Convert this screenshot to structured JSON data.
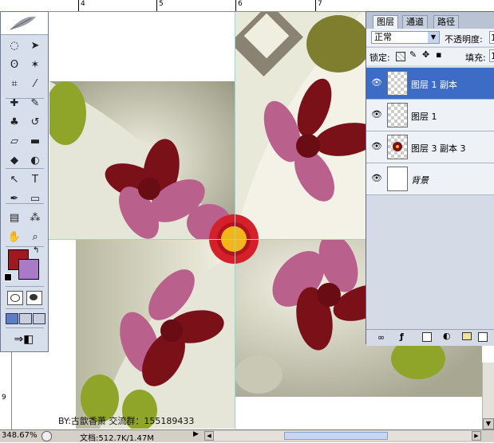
{
  "rulers": {
    "top_labels": [
      "4",
      "5",
      "6",
      "7"
    ],
    "left_labels": [
      "9"
    ]
  },
  "canvas": {
    "watermark": "BY:古歆香萧  交流群：155189433",
    "colors": {
      "petal_dark": "#7a1018",
      "petal_pink": "#b9608c",
      "leaf_green": "#8fa52a",
      "bg_cream": "#e8e7d3",
      "center_red": "#d4202a",
      "center_yellow": "#f4b51a",
      "guide": "#7fe0e0"
    }
  },
  "toolbox": {
    "tools": [
      {
        "name": "marquee-tool-icon",
        "glyph": "◌"
      },
      {
        "name": "move-tool-icon",
        "glyph": "➤"
      },
      {
        "name": "lasso-tool-icon",
        "glyph": "ʘ"
      },
      {
        "name": "magic-wand-tool-icon",
        "glyph": "✶"
      },
      {
        "name": "crop-tool-icon",
        "glyph": "⌗"
      },
      {
        "name": "slice-tool-icon",
        "glyph": "⁄"
      },
      {
        "name": "healing-brush-icon",
        "glyph": "✚"
      },
      {
        "name": "brush-tool-icon",
        "glyph": "✎"
      },
      {
        "name": "stamp-tool-icon",
        "glyph": "♣"
      },
      {
        "name": "history-brush-icon",
        "glyph": "↺"
      },
      {
        "name": "eraser-tool-icon",
        "glyph": "▱"
      },
      {
        "name": "gradient-tool-icon",
        "glyph": "▬"
      },
      {
        "name": "blur-tool-icon",
        "glyph": "◆"
      },
      {
        "name": "dodge-tool-icon",
        "glyph": "◐"
      },
      {
        "name": "path-select-tool-icon",
        "glyph": "↖"
      },
      {
        "name": "type-tool-icon",
        "glyph": "T"
      },
      {
        "name": "pen-tool-icon",
        "glyph": "✒"
      },
      {
        "name": "shape-tool-icon",
        "glyph": "▭"
      },
      {
        "name": "notes-tool-icon",
        "glyph": "▤"
      },
      {
        "name": "eyedropper-tool-icon",
        "glyph": "⁂"
      },
      {
        "name": "hand-tool-icon",
        "glyph": "✋"
      },
      {
        "name": "zoom-tool-icon",
        "glyph": "⌕"
      }
    ],
    "foreground_color": "#a01820",
    "background_color": "#a97bc7"
  },
  "layers_panel": {
    "tabs": [
      "图层",
      "通道",
      "路径"
    ],
    "blend_mode": "正常",
    "opacity_label": "不透明度:",
    "opacity_value": "1",
    "lock_label": "锁定:",
    "fill_label": "填充:",
    "fill_value": "1",
    "layers": [
      {
        "name": "图层 1 副本",
        "selected": true
      },
      {
        "name": "图层 1",
        "selected": false
      },
      {
        "name": "图层 3 副本 3",
        "selected": false
      },
      {
        "name": "背景",
        "selected": false
      }
    ]
  },
  "status": {
    "zoom": "348.67%",
    "doc_info": "文档:512.7K/1.47M"
  }
}
